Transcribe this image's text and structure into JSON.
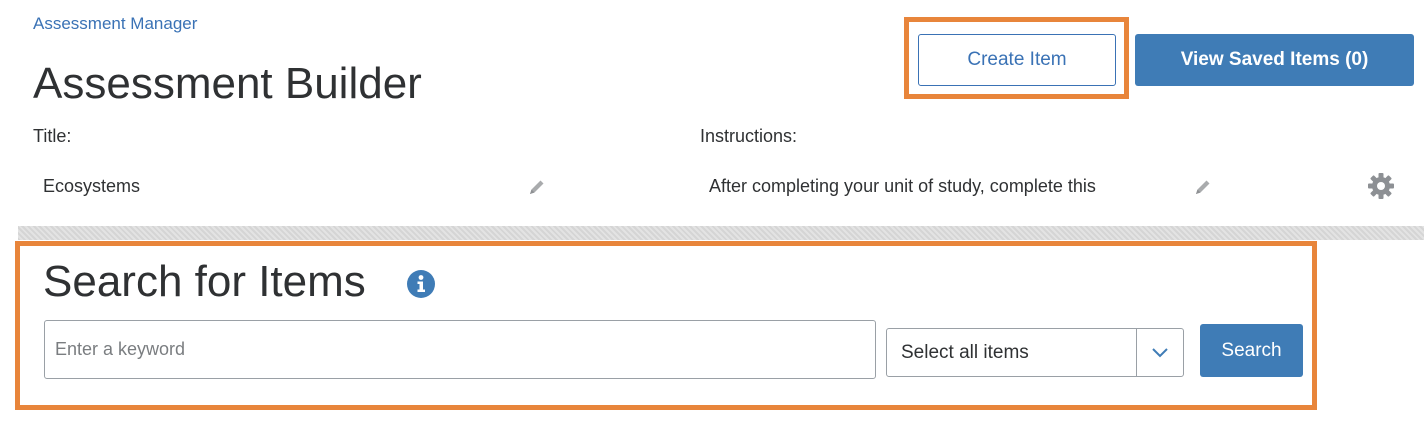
{
  "header": {
    "breadcrumb": "Assessment Manager",
    "title": "Assessment Builder",
    "create_button": "Create Item",
    "view_saved_button": "View Saved Items (0)"
  },
  "fields": {
    "title_label": "Title:",
    "title_value": "Ecosystems",
    "instructions_label": "Instructions:",
    "instructions_value": "After completing your unit of study, complete this"
  },
  "search": {
    "heading": "Search for Items",
    "placeholder": "Enter a keyword",
    "select_value": "Select all items",
    "button": "Search"
  },
  "colors": {
    "accent_blue": "#3f7cb6",
    "highlight_orange": "#e8853b"
  },
  "icons": [
    "pencil-icon",
    "gear-icon",
    "info-icon",
    "chevron-down-icon"
  ]
}
